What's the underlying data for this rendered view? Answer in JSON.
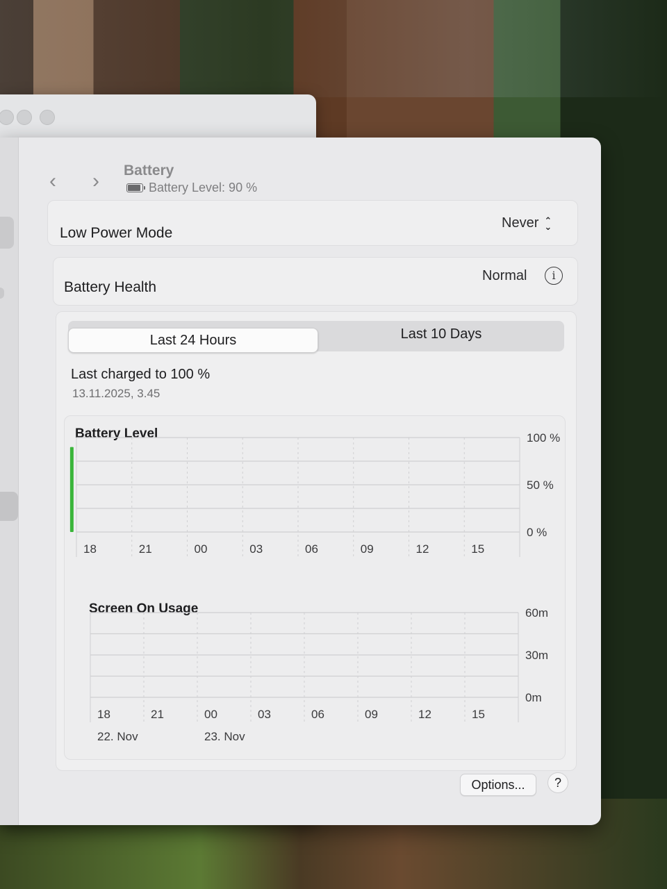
{
  "header": {
    "title": "Battery",
    "subtitle": "Battery Level: 90 %"
  },
  "rows": {
    "low_power_label": "Low Power Mode",
    "low_power_value": "Never",
    "health_label": "Battery Health",
    "health_value": "Normal"
  },
  "tabs": [
    {
      "label": "Last 24 Hours",
      "selected": true
    },
    {
      "label": "Last 10 Days",
      "selected": false
    }
  ],
  "last_charged": {
    "label": "Last charged to 100 %",
    "date": "13.11.2025, 3.45"
  },
  "chart_data": [
    {
      "type": "bar",
      "title": "Battery Level",
      "x_ticks": [
        "18",
        "21",
        "00",
        "03",
        "06",
        "09",
        "12",
        "15"
      ],
      "y_ticks": [
        "100 %",
        "50 %",
        "0 %"
      ],
      "ylim": [
        0,
        100
      ],
      "bar_color": "#3ab53a",
      "bars": [
        {
          "hour": 16.25,
          "value": 90
        },
        {
          "hour": 16.5,
          "value": 90
        },
        {
          "hour": 16.75,
          "value": 90
        },
        {
          "hour": 17.0,
          "value": 90
        },
        {
          "hour": 17.25,
          "value": 90
        },
        {
          "hour": 17.5,
          "value": 90
        },
        {
          "hour": 17.75,
          "value": 90
        }
      ]
    },
    {
      "type": "bar",
      "title": "Screen On Usage",
      "x_ticks": [
        "18",
        "21",
        "00",
        "03",
        "06",
        "09",
        "12",
        "15"
      ],
      "date_labels": [
        {
          "at_tick": "18",
          "label": "22. Nov"
        },
        {
          "at_tick": "00",
          "label": "23. Nov"
        }
      ],
      "y_ticks": [
        "60m",
        "30m",
        "0m"
      ],
      "ylim": [
        0,
        60
      ],
      "bars": []
    }
  ],
  "footer": {
    "options_label": "Options...",
    "help_label": "?"
  },
  "icons": {
    "back": "chevron-left-icon",
    "forward": "chevron-right-icon",
    "battery": "battery-icon",
    "popup": "up-down-chevron-icon",
    "info": "info-icon"
  }
}
